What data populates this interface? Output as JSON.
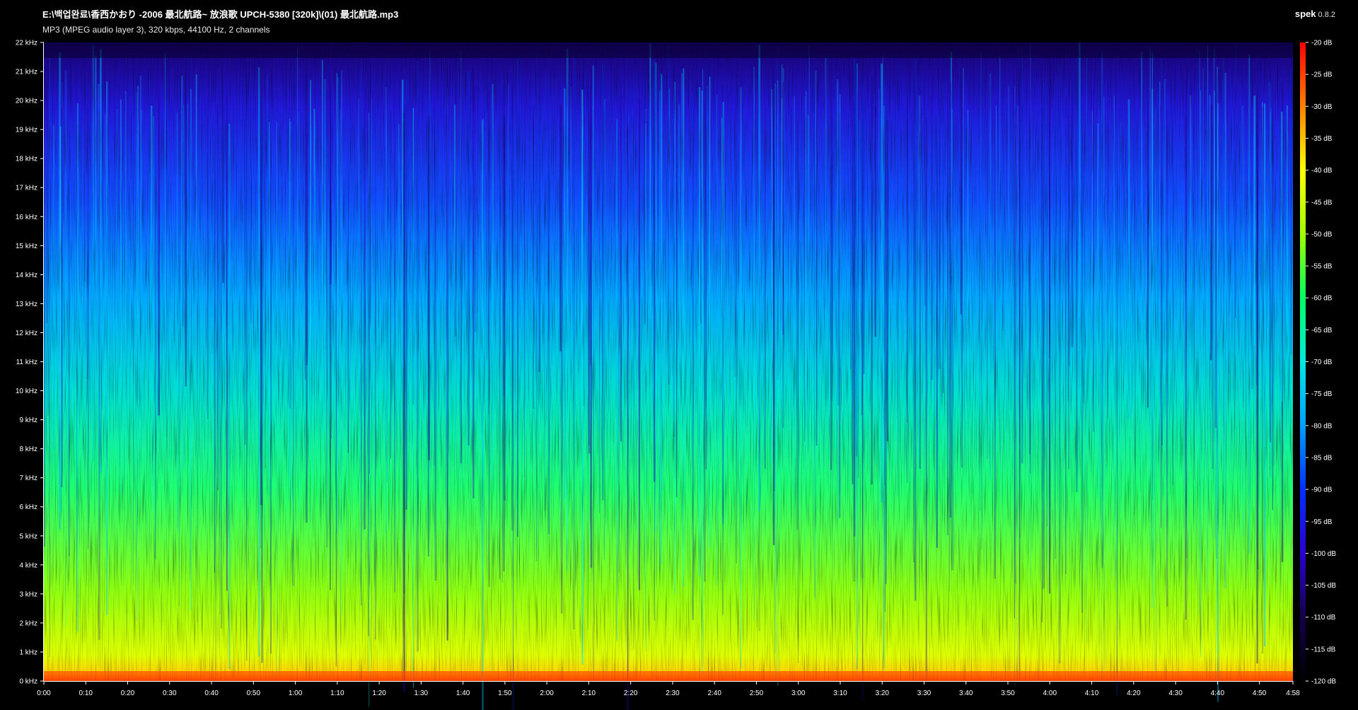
{
  "header": {
    "file_path": "E:\\백업완료\\香西かおり -2006 最北航路~ 放浪歌 UPCH-5380 [320k]\\(01) 最北航路.mp3",
    "file_info": "MP3 (MPEG audio layer 3), 320 kbps, 44100 Hz, 2 channels",
    "app_name": "spek",
    "app_version": "0.8.2"
  },
  "chart_data": {
    "type": "heatmap",
    "title": "",
    "xlabel": "",
    "ylabel": "",
    "x_unit": "time (m:ss)",
    "y_unit": "frequency",
    "xlim_seconds": [
      0,
      298
    ],
    "ylim_khz": [
      0,
      22
    ],
    "x_ticks": [
      "0:00",
      "0:10",
      "0:20",
      "0:30",
      "0:40",
      "0:50",
      "1:00",
      "1:10",
      "1:20",
      "1:30",
      "1:40",
      "1:50",
      "2:00",
      "2:10",
      "2:20",
      "2:30",
      "2:40",
      "2:50",
      "3:00",
      "3:10",
      "3:20",
      "3:30",
      "3:40",
      "3:50",
      "4:00",
      "4:10",
      "4:20",
      "4:30",
      "4:40",
      "4:50",
      "4:58"
    ],
    "y_ticks": [
      "0 kHz",
      "1 kHz",
      "2 kHz",
      "3 kHz",
      "4 kHz",
      "5 kHz",
      "6 kHz",
      "7 kHz",
      "8 kHz",
      "9 kHz",
      "10 kHz",
      "11 kHz",
      "12 kHz",
      "13 kHz",
      "14 kHz",
      "15 kHz",
      "16 kHz",
      "17 kHz",
      "18 kHz",
      "19 kHz",
      "20 kHz",
      "21 kHz",
      "22 kHz"
    ],
    "colorbar": {
      "unit": "dB",
      "range_db": [
        -120,
        -20
      ],
      "ticks": [
        "-20 dB",
        "-25 dB",
        "-30 dB",
        "-35 dB",
        "-40 dB",
        "-45 dB",
        "-50 dB",
        "-55 dB",
        "-60 dB",
        "-65 dB",
        "-70 dB",
        "-75 dB",
        "-80 dB",
        "-85 dB",
        "-90 dB",
        "-95 dB",
        "-100 dB",
        "-105 dB",
        "-110 dB",
        "-115 dB",
        "-120 dB"
      ],
      "colors": [
        "#000000",
        "#14004a",
        "#2a00d0",
        "#0030ff",
        "#00a0ff",
        "#00e8e0",
        "#00ff60",
        "#a0ff00",
        "#ffff00",
        "#ff8000",
        "#ff0000"
      ]
    }
  }
}
